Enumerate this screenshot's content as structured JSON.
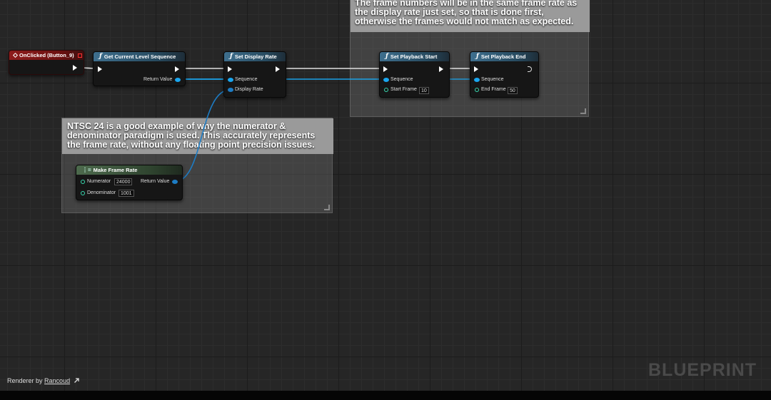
{
  "comments": {
    "top": {
      "text": "The frame numbers will be in the same frame rate as the display rate just set, so that is done first, otherwise the frames would not match as expected."
    },
    "left": {
      "text": "NTSC 24 is a good example of why the numerator & denominator paradigm is used. This accurately represents the frame rate, without any floating point precision issues."
    }
  },
  "nodes": {
    "on_clicked": {
      "title": "OnClicked (Button_9)"
    },
    "get_sequence": {
      "title": "Get Current Level Sequence",
      "return_label": "Return Value"
    },
    "set_display_rate": {
      "title": "Set Display Rate",
      "sequence_label": "Sequence",
      "display_rate_label": "Display Rate"
    },
    "set_playback_start": {
      "title": "Set Playback Start",
      "sequence_label": "Sequence",
      "start_frame_label": "Start Frame",
      "start_frame_value": "10"
    },
    "set_playback_end": {
      "title": "Set Playback End",
      "sequence_label": "Sequence",
      "end_frame_label": "End Frame",
      "end_frame_value": "50"
    },
    "make_frame_rate": {
      "title": "Make Frame Rate",
      "numerator_label": "Numerator",
      "numerator_value": "24000",
      "denominator_label": "Denominator",
      "denominator_value": "1001",
      "return_label": "Return Value"
    }
  },
  "footer": {
    "renderer_prefix": "Renderer by",
    "renderer_link": "Rancoud",
    "link_icon": "arrow-up-right-icon",
    "watermark": "BLUEPRINT"
  },
  "colors": {
    "exec_wire": "#e0e0e0",
    "object_wire": "#1aa6ef",
    "struct_wire": "#1d7cc4",
    "event_header": "#8e1c1c",
    "function_header": "#3e6f8e",
    "make_header": "#4d6a4d"
  }
}
